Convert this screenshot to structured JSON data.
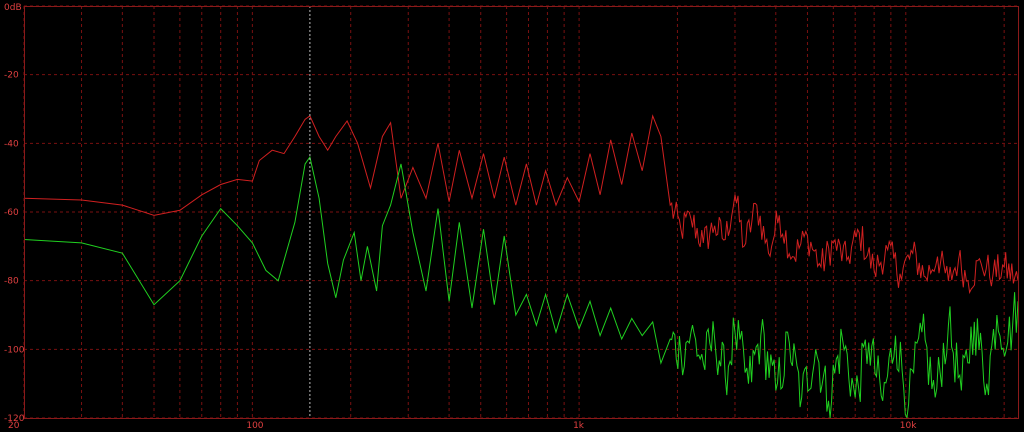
{
  "chart_data": {
    "type": "line",
    "x_scale": "log",
    "xlim": [
      20,
      22050
    ],
    "ylim": [
      -120,
      0
    ],
    "grid": true,
    "y_ticks": [
      {
        "value": 0,
        "label": "0dB"
      },
      {
        "value": -20,
        "label": "-20"
      },
      {
        "value": -40,
        "label": "-40"
      },
      {
        "value": -60,
        "label": "-60"
      },
      {
        "value": -80,
        "label": "-80"
      },
      {
        "value": -100,
        "label": "-100"
      },
      {
        "value": -120,
        "label": "-120"
      }
    ],
    "x_ticks": [
      {
        "value": 20,
        "label": "20"
      },
      {
        "value": 100,
        "label": "100"
      },
      {
        "value": 1000,
        "label": "1k"
      },
      {
        "value": 10000,
        "label": "10k"
      }
    ],
    "cursor_x": 150,
    "colors": {
      "background": "#000000",
      "grid": "#7a1010",
      "axis_text": "#e04040",
      "cursor": "#bbbbbb"
    },
    "series": [
      {
        "color": "#d02020",
        "points": [
          [
            20,
            -56
          ],
          [
            30,
            -56.5
          ],
          [
            40,
            -58
          ],
          [
            50,
            -61
          ],
          [
            60,
            -59.5
          ],
          [
            70,
            -55
          ],
          [
            80,
            -52
          ],
          [
            90,
            -50.5
          ],
          [
            100,
            -51
          ],
          [
            105,
            -45
          ],
          [
            115,
            -42
          ],
          [
            125,
            -43
          ],
          [
            135,
            -38
          ],
          [
            145,
            -33
          ],
          [
            150,
            -32
          ],
          [
            160,
            -38
          ],
          [
            170,
            -42
          ],
          [
            180,
            -38
          ],
          [
            195,
            -33.5
          ],
          [
            210,
            -40
          ],
          [
            230,
            -53
          ],
          [
            250,
            -38
          ],
          [
            265,
            -34
          ],
          [
            285,
            -56
          ],
          [
            310,
            -47
          ],
          [
            340,
            -56
          ],
          [
            370,
            -40
          ],
          [
            400,
            -57
          ],
          [
            430,
            -42
          ],
          [
            470,
            -56
          ],
          [
            510,
            -43
          ],
          [
            550,
            -56
          ],
          [
            590,
            -44
          ],
          [
            640,
            -58
          ],
          [
            690,
            -46
          ],
          [
            740,
            -58
          ],
          [
            790,
            -48
          ],
          [
            850,
            -58
          ],
          [
            920,
            -50
          ],
          [
            1000,
            -57
          ],
          [
            1080,
            -43
          ],
          [
            1160,
            -55
          ],
          [
            1250,
            -39
          ],
          [
            1350,
            -52
          ],
          [
            1450,
            -37
          ],
          [
            1560,
            -48
          ],
          [
            1680,
            -32
          ],
          [
            1780,
            -38
          ],
          [
            1900,
            -58
          ],
          [
            2050,
            -65
          ],
          [
            2200,
            -62
          ],
          [
            2400,
            -69
          ],
          [
            2600,
            -64
          ],
          [
            2800,
            -68
          ],
          [
            3000,
            -55
          ],
          [
            3200,
            -70
          ],
          [
            3500,
            -58
          ],
          [
            3800,
            -72
          ],
          [
            4100,
            -61
          ],
          [
            4500,
            -73
          ],
          [
            5000,
            -67
          ],
          [
            5500,
            -76
          ],
          [
            6000,
            -69
          ],
          [
            6600,
            -74
          ],
          [
            7200,
            -66
          ],
          [
            8000,
            -77
          ],
          [
            8800,
            -71
          ],
          [
            9600,
            -78
          ],
          [
            10500,
            -72
          ],
          [
            11500,
            -79
          ],
          [
            12500,
            -73
          ],
          [
            13500,
            -80
          ],
          [
            14500,
            -74
          ],
          [
            15500,
            -80
          ],
          [
            17000,
            -75
          ],
          [
            18500,
            -78
          ],
          [
            20000,
            -76
          ],
          [
            22050,
            -80
          ]
        ]
      },
      {
        "color": "#20d020",
        "points": [
          [
            20,
            -68
          ],
          [
            30,
            -69
          ],
          [
            40,
            -72
          ],
          [
            50,
            -87
          ],
          [
            60,
            -80
          ],
          [
            70,
            -67
          ],
          [
            80,
            -59
          ],
          [
            90,
            -64
          ],
          [
            100,
            -69
          ],
          [
            110,
            -77
          ],
          [
            120,
            -80
          ],
          [
            135,
            -63
          ],
          [
            145,
            -46
          ],
          [
            150,
            -44
          ],
          [
            160,
            -56
          ],
          [
            170,
            -75
          ],
          [
            180,
            -85
          ],
          [
            190,
            -74
          ],
          [
            205,
            -66
          ],
          [
            215,
            -80
          ],
          [
            225,
            -70
          ],
          [
            240,
            -83
          ],
          [
            250,
            -64
          ],
          [
            265,
            -58
          ],
          [
            285,
            -46
          ],
          [
            310,
            -66
          ],
          [
            340,
            -83
          ],
          [
            370,
            -59
          ],
          [
            400,
            -86
          ],
          [
            430,
            -63
          ],
          [
            470,
            -88
          ],
          [
            510,
            -65
          ],
          [
            550,
            -87
          ],
          [
            590,
            -67
          ],
          [
            640,
            -90
          ],
          [
            690,
            -84
          ],
          [
            740,
            -93
          ],
          [
            790,
            -84
          ],
          [
            850,
            -95
          ],
          [
            920,
            -84
          ],
          [
            1000,
            -94
          ],
          [
            1080,
            -86
          ],
          [
            1160,
            -96
          ],
          [
            1250,
            -88
          ],
          [
            1350,
            -97
          ],
          [
            1450,
            -91
          ],
          [
            1560,
            -96
          ],
          [
            1680,
            -92
          ],
          [
            1780,
            -104
          ],
          [
            1900,
            -97
          ],
          [
            2050,
            -101
          ],
          [
            2200,
            -95
          ],
          [
            2400,
            -104
          ],
          [
            2600,
            -97
          ],
          [
            2800,
            -108
          ],
          [
            3000,
            -95
          ],
          [
            3300,
            -110
          ],
          [
            3600,
            -96
          ],
          [
            4000,
            -112
          ],
          [
            4400,
            -98
          ],
          [
            4800,
            -114
          ],
          [
            5300,
            -100
          ],
          [
            5800,
            -115
          ],
          [
            6400,
            -97
          ],
          [
            7000,
            -114
          ],
          [
            7700,
            -98
          ],
          [
            8500,
            -115
          ],
          [
            9300,
            -96
          ],
          [
            10200,
            -116
          ],
          [
            11200,
            -95
          ],
          [
            12300,
            -114
          ],
          [
            13500,
            -93
          ],
          [
            14800,
            -112
          ],
          [
            16200,
            -92
          ],
          [
            17700,
            -110
          ],
          [
            19000,
            -90
          ],
          [
            20500,
            -98
          ],
          [
            22050,
            -86
          ]
        ]
      }
    ]
  }
}
